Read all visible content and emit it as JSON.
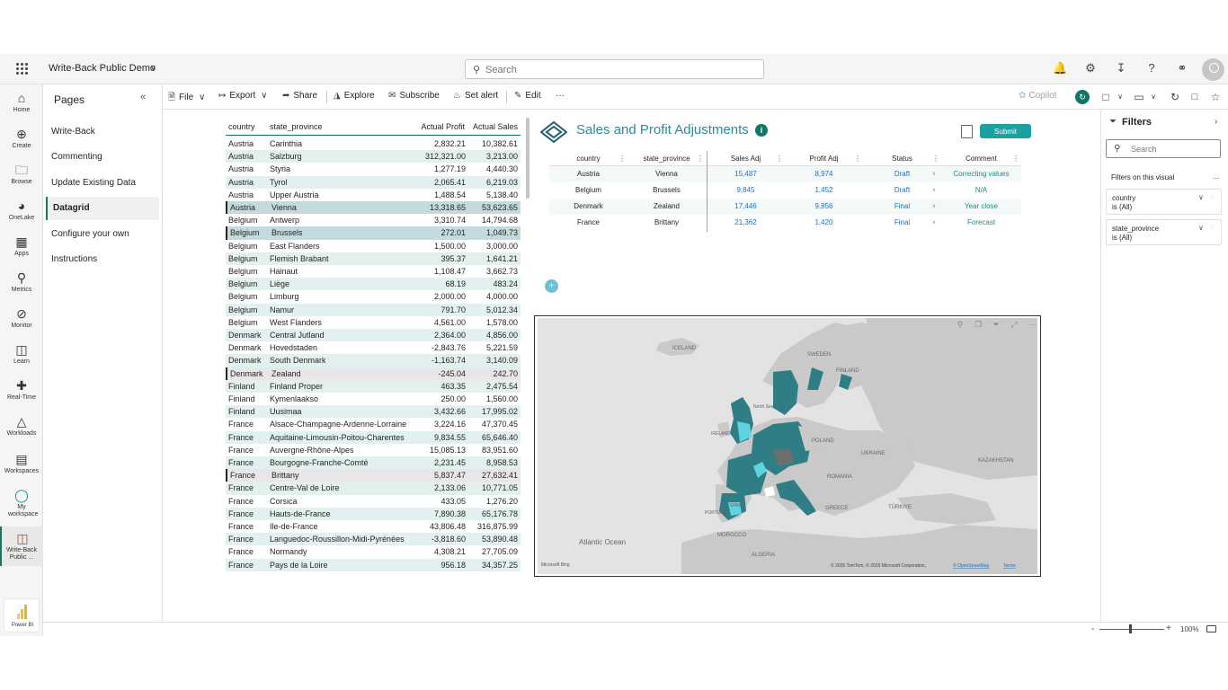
{
  "app": {
    "title": "Write-Back Public Demo",
    "search_placeholder": "Search",
    "accent": "#117865"
  },
  "topbar_icons": [
    "bell-icon",
    "settings-icon",
    "download-icon",
    "help-icon",
    "share-link-icon",
    "account-avatar"
  ],
  "rail": {
    "items": [
      {
        "label": "Home",
        "icon": "home-icon"
      },
      {
        "label": "Create",
        "icon": "create-icon"
      },
      {
        "label": "Browse",
        "icon": "folder-icon"
      },
      {
        "label": "OneLake",
        "icon": "onelake-icon"
      },
      {
        "label": "Apps",
        "icon": "apps-icon"
      },
      {
        "label": "Metrics",
        "icon": "trophy-icon"
      },
      {
        "label": "Monitor",
        "icon": "monitor-icon"
      },
      {
        "label": "Learn",
        "icon": "book-icon"
      },
      {
        "label": "Real-Time",
        "icon": "lightning-icon"
      },
      {
        "label": "Workloads",
        "icon": "workloads-icon"
      },
      {
        "label": "Workspaces",
        "icon": "workspaces-icon"
      },
      {
        "label": "My workspace",
        "icon": "person-icon"
      },
      {
        "label": "Write-Back Public ...",
        "icon": "report-icon"
      }
    ],
    "product": "Power BI"
  },
  "pages": {
    "title": "Pages",
    "items": [
      "Write-Back",
      "Commenting",
      "Update Existing Data",
      "Datagrid",
      "Configure your own",
      "Instructions"
    ],
    "active": "Datagrid"
  },
  "toolbar": {
    "file": "File",
    "export": "Export",
    "share": "Share",
    "explore": "Explore",
    "subscribe": "Subscribe",
    "set_alert": "Set alert",
    "edit": "Edit",
    "more": "···",
    "copilot": "Copilot"
  },
  "datatable": {
    "headers": [
      "country",
      "state_province",
      "Actual Profit",
      "Actual Sales"
    ],
    "rows": [
      [
        "Austria",
        "Carinthia",
        "2,832.21",
        "10,382.61"
      ],
      [
        "Austria",
        "Salzburg",
        "312,321.00",
        "3,213.00"
      ],
      [
        "Austria",
        "Styria",
        "1,277.19",
        "4,440.30"
      ],
      [
        "Austria",
        "Tyrol",
        "2,065.41",
        "6,219.03"
      ],
      [
        "Austria",
        "Upper Austria",
        "1,488.54",
        "5,138.40"
      ],
      [
        "Austria",
        "Vienna",
        "13,318.65",
        "53,623.65"
      ],
      [
        "Belgium",
        "Antwerp",
        "3,310.74",
        "14,794.68"
      ],
      [
        "Belgium",
        "Brussels",
        "272.01",
        "1,049.73"
      ],
      [
        "Belgium",
        "East Flanders",
        "1,500.00",
        "3,000.00"
      ],
      [
        "Belgium",
        "Flemish Brabant",
        "395.37",
        "1,641.21"
      ],
      [
        "Belgium",
        "Hainaut",
        "1,108.47",
        "3,662.73"
      ],
      [
        "Belgium",
        "Liège",
        "68.19",
        "483.24"
      ],
      [
        "Belgium",
        "Limburg",
        "2,000.00",
        "4,000.00"
      ],
      [
        "Belgium",
        "Namur",
        "791.70",
        "5,012.34"
      ],
      [
        "Belgium",
        "West Flanders",
        "4,561.00",
        "1,578.00"
      ],
      [
        "Denmark",
        "Central Jutland",
        "2,364.00",
        "4,856.00"
      ],
      [
        "Denmark",
        "Hovedstaden",
        "-2,843.76",
        "5,221.59"
      ],
      [
        "Denmark",
        "South Denmark",
        "-1,163.74",
        "3,140.09"
      ],
      [
        "Denmark",
        "Zealand",
        "-245.04",
        "242.70"
      ],
      [
        "Finland",
        "Finland Proper",
        "463.35",
        "2,475.54"
      ],
      [
        "Finland",
        "Kymenlaakso",
        "250.00",
        "1,560.00"
      ],
      [
        "Finland",
        "Uusimaa",
        "3,432.66",
        "17,995.02"
      ],
      [
        "France",
        "Alsace-Champagne-Ardenne-Lorraine",
        "3,224.16",
        "47,370.45"
      ],
      [
        "France",
        "Aquitaine-Limousin-Poitou-Charentes",
        "9,834.55",
        "65,646.40"
      ],
      [
        "France",
        "Auvergne-Rhône-Alpes",
        "15,085.13",
        "83,951.60"
      ],
      [
        "France",
        "Bourgogne-Franche-Comté",
        "2,231.45",
        "8,958.53"
      ],
      [
        "France",
        "Brittany",
        "5,837.47",
        "27,632.41"
      ],
      [
        "France",
        "Centre-Val de Loire",
        "2,133.06",
        "10,771.05"
      ],
      [
        "France",
        "Corsica",
        "433.05",
        "1,276.20"
      ],
      [
        "France",
        "Hauts-de-France",
        "7,890.38",
        "65,176.78"
      ],
      [
        "France",
        "Ile-de-France",
        "43,806.48",
        "316,875.99"
      ],
      [
        "France",
        "Languedoc-Roussillon-Midi-Pyrénées",
        "-3,818.60",
        "53,890.48"
      ],
      [
        "France",
        "Normandy",
        "4,308.21",
        "27,705.09"
      ],
      [
        "France",
        "Pays de la Loire",
        "956.18",
        "34,357.25"
      ]
    ]
  },
  "adjustments": {
    "title": "Sales and Profit Adjustments",
    "info": "i",
    "submit": "Submit",
    "headers": [
      "country",
      "state_province",
      "Sales Adj",
      "Profit Adj",
      "Status",
      "Comment"
    ],
    "rows": [
      [
        "Austria",
        "Vienna",
        "15,487",
        "8,974",
        "Draft",
        "Correcting values"
      ],
      [
        "Belgium",
        "Brussels",
        "9,845",
        "1,452",
        "Draft",
        "N/A"
      ],
      [
        "Denmark",
        "Zealand",
        "17,446",
        "9,856",
        "Final",
        "Year close"
      ],
      [
        "France",
        "Brittany",
        "21,362",
        "1,420",
        "Final",
        "Forecast"
      ]
    ],
    "add": "+"
  },
  "map": {
    "labels": [
      "ICELAND",
      "SWEDEN",
      "FINLAND",
      "North Sea",
      "IRELAND",
      "POLAND",
      "UKRAINE",
      "KAZAKHSTAN",
      "ROMANIA",
      "PORTUGAL",
      "SPAIN",
      "GREECE",
      "TÜRKIYE",
      "MOROCCO",
      "ALGERIA",
      "Atlantic Ocean"
    ],
    "attribution": "© 2025 TomTom, © 2025 Microsoft Corporation,",
    "osm": "© OpenStreetMap",
    "terms": "Terms",
    "bing": "Microsoft Bing",
    "colors": {
      "land": "#c9c9c9",
      "sea": "#e3e3e3",
      "fill_dark": "#2f7e86",
      "fill_light": "#5fd3e0",
      "fill_gray": "#6e6e6e"
    }
  },
  "filters": {
    "title": "Filters",
    "search_placeholder": "Search",
    "section": "Filters on this visual",
    "more": "...",
    "cards": [
      {
        "name": "country",
        "value": "is (All)"
      },
      {
        "name": "state_province",
        "value": "is (All)"
      }
    ]
  },
  "status": {
    "zoom": "100%",
    "minus": "-",
    "plus": "+"
  }
}
